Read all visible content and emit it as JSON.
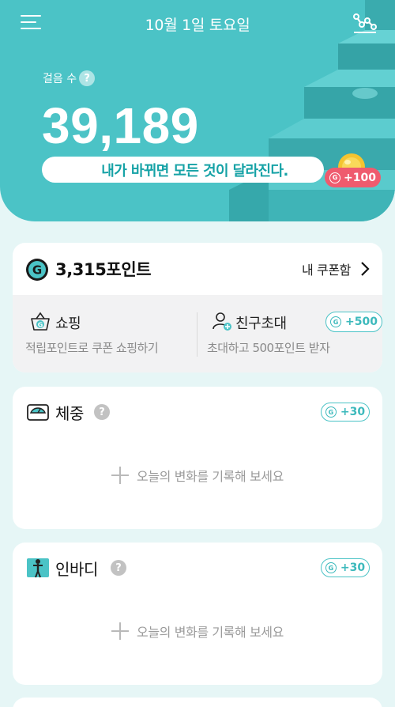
{
  "header": {
    "date_title": "10월 1일 토요일",
    "menu_icon": "hamburger-menu-icon",
    "graph_icon": "step-graph-icon"
  },
  "hero": {
    "steps_label": "걸음 수",
    "help_glyph": "?",
    "steps_value": "39,189",
    "slogan": "내가 바뀌면 모든 것이 달라진다.",
    "reward_icon_glyph": "G",
    "reward_badge": "+100",
    "colors": {
      "hero_bg": "#4bc3c6",
      "slogan_text": "#16a2a6",
      "reward_badge_bg": "#ef5b6e"
    }
  },
  "points": {
    "coin_icon": "g-point-coin-icon",
    "value": "3,315포인트",
    "coupon_link": "내 쿠폰함",
    "shop": {
      "title": "쇼핑",
      "description": "적립포인트로 쿠폰 쇼핑하기",
      "icon": "shopping-basket-icon"
    },
    "invite": {
      "title": "친구초대",
      "description": "초대하고 500포인트 받자",
      "reward": "+500",
      "icon": "add-friend-icon"
    }
  },
  "records": [
    {
      "title": "체중",
      "icon": "scale-icon",
      "help_glyph": "?",
      "reward": "+30",
      "prompt": "오늘의 변화를 기록해 보세요"
    },
    {
      "title": "인바디",
      "icon": "body-composition-icon",
      "help_glyph": "?",
      "reward": "+30",
      "prompt": "오늘의 변화를 기록해 보세요"
    }
  ],
  "colors": {
    "accent": "#4bc3c6",
    "page_bg": "#e6f6f6",
    "muted_text": "#9b9b9b"
  }
}
